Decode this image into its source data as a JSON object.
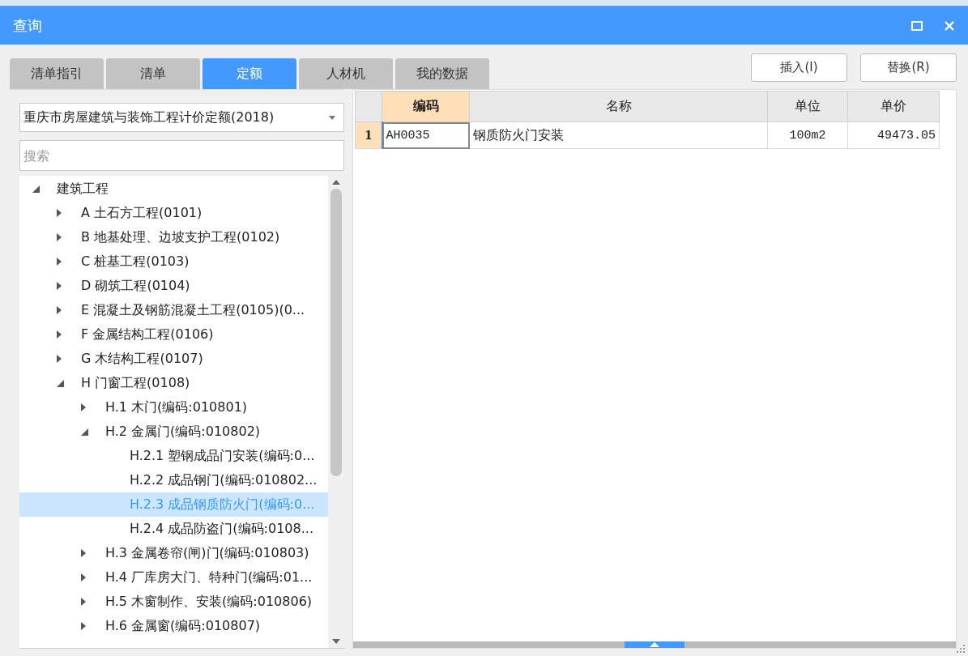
{
  "window": {
    "title": "查询"
  },
  "tabs": [
    {
      "label": "清单指引",
      "selected": false
    },
    {
      "label": "清单",
      "selected": false
    },
    {
      "label": "定额",
      "selected": true
    },
    {
      "label": "人材机",
      "selected": false
    },
    {
      "label": "我的数据",
      "selected": false
    }
  ],
  "action_buttons": [
    "插入(I)",
    "替换(R)"
  ],
  "library_dropdown": {
    "value": "重庆市房屋建筑与装饰工程计价定额(2018)"
  },
  "search": {
    "placeholder": "搜索"
  },
  "tree": [
    {
      "label": "建筑工程",
      "expanded": true,
      "selected": false,
      "children": [
        {
          "label": "A 土石方工程(0101)",
          "expanded": false,
          "selected": false
        },
        {
          "label": "B 地基处理、边坡支护工程(0102)",
          "expanded": false,
          "selected": false
        },
        {
          "label": "C 桩基工程(0103)",
          "expanded": false,
          "selected": false
        },
        {
          "label": "D 砌筑工程(0104)",
          "expanded": false,
          "selected": false
        },
        {
          "label": "E 混凝土及钢筋混凝土工程(0105)(0...",
          "expanded": false,
          "selected": false
        },
        {
          "label": "F 金属结构工程(0106)",
          "expanded": false,
          "selected": false
        },
        {
          "label": "G 木结构工程(0107)",
          "expanded": false,
          "selected": false
        },
        {
          "label": "H 门窗工程(0108)",
          "expanded": true,
          "selected": false,
          "children": [
            {
              "label": "H.1 木门(编码:010801)",
              "expanded": false,
              "selected": false
            },
            {
              "label": "H.2 金属门(编码:010802)",
              "expanded": true,
              "selected": false,
              "children": [
                {
                  "label": "H.2.1 塑钢成品门安装(编码:0...",
                  "selected": false
                },
                {
                  "label": "H.2.2 成品钢门(编码:010802...",
                  "selected": false
                },
                {
                  "label": "H.2.3 成品钢质防火门(编码:0...",
                  "selected": true
                },
                {
                  "label": "H.2.4 成品防盗门(编码:0108...",
                  "selected": false
                }
              ]
            },
            {
              "label": "H.3 金属卷帘(闸)门(编码:010803)",
              "expanded": false,
              "selected": false
            },
            {
              "label": "H.4 厂库房大门、特种门(编码:01...",
              "expanded": false,
              "selected": false
            },
            {
              "label": "H.5 木窗制作、安装(编码:010806)",
              "expanded": false,
              "selected": false
            },
            {
              "label": "H.6 金属窗(编码:010807)",
              "expanded": false,
              "selected": false
            }
          ]
        }
      ]
    }
  ],
  "table": {
    "columns": [
      {
        "label": "编码",
        "selected": true
      },
      {
        "label": "名称",
        "selected": false
      },
      {
        "label": "单位",
        "selected": false
      },
      {
        "label": "单价",
        "selected": false
      }
    ],
    "rows": [
      {
        "number": "1",
        "selected": true,
        "cells": [
          "AH0035",
          "钢质防火门安装",
          "100m2",
          "49473.05"
        ]
      }
    ]
  }
}
